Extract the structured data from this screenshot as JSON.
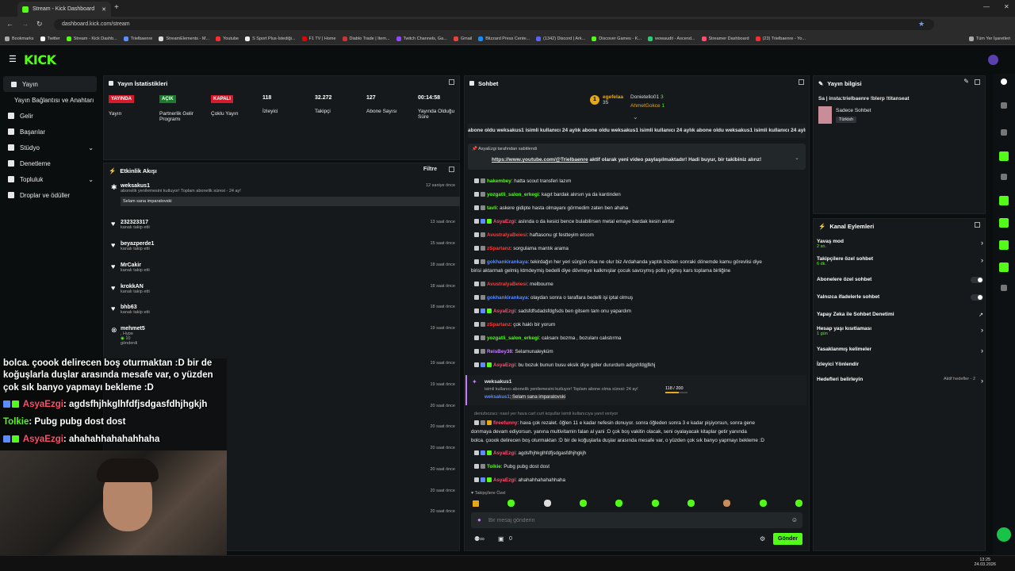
{
  "browser": {
    "tab_title": "Stream - Kick Dashboard",
    "url": "dashboard.kick.com/stream",
    "bookmarks": [
      "Bookmarks",
      "Twitter",
      "Stream - Kick Dashb...",
      "Trielbaenre",
      "StreamElements - M...",
      "Youtube",
      "S Sport Plus-İstediği...",
      "F1 TV | Home",
      "Diablo Trade | Item...",
      "Twitch Channels, Ga...",
      "Gmail",
      "Blizzard Press Cente...",
      "(1342) Discord | Ark...",
      "Discover Games - K...",
      "wowaudit - Ascend...",
      "Streamer Dashboard",
      "(23) Trielbaenre - Yo..."
    ],
    "all_bookmarks": "Tüm Yer İşaretleri"
  },
  "nav": {
    "items": [
      "Yayın",
      "Yayın Bağlantısı ve Anahtarı",
      "Gelir",
      "Başarılar",
      "Stüdyo",
      "Denetleme",
      "Topluluk",
      "Droplar ve ödüller"
    ]
  },
  "stats": {
    "title": "Yayın İstatistikleri",
    "live_tag": "YAYINDA",
    "live_label": "Yayın",
    "partner_tag": "AÇIK",
    "partner_label": "Partnerlik Gelir Programı",
    "multi_tag": "KAPALI",
    "multi_label": "Çoklu Yayın",
    "viewers": "118",
    "viewers_label": "İzleyici",
    "followers": "32.272",
    "followers_label": "Takipçi",
    "subs": "127",
    "subs_label": "Abone Sayısı",
    "uptime": "00:14:58",
    "uptime_label": "Yayında Olduğu Süre"
  },
  "activity": {
    "title": "Etkinlik Akışı",
    "filter": "Filtre",
    "sub_user": "weksakus1",
    "sub_text": "abonelik yenilemesini kutluyor! Toplam abonelik süresi - 24 ay!",
    "sub_time": "12 saniye önce",
    "sub_msg": "Selam sana imparatovski",
    "events": [
      {
        "name": "232323317",
        "desc": "kanalı takip etti",
        "time": "13 saat önce"
      },
      {
        "name": "beyazperde1",
        "desc": "kanalı takip etti",
        "time": "15 saat önce"
      },
      {
        "name": "MrCakir",
        "desc": "kanalı takip etti",
        "time": "18 saat önce"
      },
      {
        "name": "krokkAN",
        "desc": "kanalı takip etti",
        "time": "18 saat önce"
      },
      {
        "name": "bhb63",
        "desc": "kanalı takip etti",
        "time": "18 saat önce"
      },
      {
        "name": "mehmet5",
        "desc": ", Hype",
        "time": "19 saat önce"
      }
    ],
    "hype_amount": "10",
    "hype_sent": "gönderdi",
    "more_times": [
      "19 saat önce",
      "19 saat önce",
      "20 saat önce",
      "20 saat önce",
      "20 saat önce",
      "20 saat önce",
      "20 saat önce",
      "20 saat önce"
    ]
  },
  "chat": {
    "title": "Sohbet",
    "top1_name": "egefelaa",
    "top1_count": "35",
    "top2_name": "Donietello01",
    "top2_count": "3",
    "top3_name": "AhmetGokce",
    "top3_count": "1",
    "ticker": "abone oldu  weksakus1 isimli kullanıcı 24 aylık abone oldu  weksakus1 isimli kullanıcı 24 aylık abone oldu  weksakus1 isimli kullanıcı 24 aylık abone oldu",
    "pinned_by": "AsyaEzgi tarafından sabitlendi",
    "pinned_link": "https://www.youtube.com/@Trielbaenre",
    "pinned_text": " aktif olarak yeni video paylaşılmaktadır! Hadi buyur, bir takibiniz alırız!",
    "messages": [
      {
        "user": "hakembey",
        "color": "#53fc18",
        "text": ": hatta scout transferi lazım"
      },
      {
        "user": "yozgatli_salon_erkegi",
        "color": "#53fc18",
        "text": ": kagıt bardak alırsın ya da kantinden"
      },
      {
        "user": "tavli",
        "color": "#53fc18",
        "text": ": askere gidipte hasta olmayanı görmedim zaten ben ahaha"
      },
      {
        "user": "AsyaEzgi",
        "color": "#ff4d6d",
        "text": ": aslında o da kesici bence bulabilirsen metal emaye bardak kesin alırlar"
      },
      {
        "user": "AvustralyaBeiesi",
        "color": "#ff3b3b",
        "text": ": haftasonu gt festteyim ercom"
      },
      {
        "user": "zSpartanz",
        "color": "#ff3b3b",
        "text": ": sorgulama mantık arama"
      },
      {
        "user": "gokhankirankaya",
        "color": "#5b8dff",
        "text": ": tekirdağın her yeri sürgün olsa ne olur biz Ardahanda yaptık bizden sonraki dönemde kamu görevlisi diye"
      },
      {
        "user": "AvustralyaBeiesi",
        "color": "#ff3b3b",
        "text": ": melbourne"
      },
      {
        "user": "gokhankirankaya",
        "color": "#5b8dff",
        "text": ": olaydan sonra o taraflara bedelli işi iptal olmuş"
      },
      {
        "user": "AsyaEzgi",
        "color": "#ff4d6d",
        "text": ": sadsfdfsdadsfdgfsds ben gitsem tam onu yapardım"
      },
      {
        "user": "zSpartanz",
        "color": "#ff3b3b",
        "text": ": çok haklı bir yorum"
      },
      {
        "user": "yozgatli_salon_erkegi",
        "color": "#53fc18",
        "text": ": calısanı bozma , bozulanı calıstırma"
      },
      {
        "user": "ReisBey38",
        "color": "#c77dff",
        "text": ": Selamunaleyküm"
      },
      {
        "user": "AsyaEzgi",
        "color": "#ff4d6d",
        "text": ": bu bozuk bunun busu eksik diye gider dururdum adgshfdgjfkhj"
      }
    ],
    "wrap_line": "birisi aktarmalı gelmiş ktmdeymiş bedelli diye dövmeye kalkmışlar çocuk savcıymış polis yığmış kars toplama birliğine",
    "sub_user": "weksakus1",
    "sub_text": "isimli kullanıcı abonelik yenilemesini kutluyor! Toplam abone olma süresi: 24 ay!",
    "sub_progress": "118 / 200",
    "sub_reply_user": "weksakus1",
    "sub_reply": ": Selam sana imparatovski",
    "reply_hint": "denizbozacı: nasıl yer hava cart curt koşullar isimli kullanıcıya yanıt veriyor",
    "long_user": "fireefunny",
    "long1": ": hava çok rezalet. öğlen 11 e kadar nefesin donuyor. sonra öğleden sonra 3 e kadar pişiyorsun, sonra gene",
    "long2": "donmaya devam ediyorsun.        yanına multivitamin falan al yani :D çok boş vakitin olacak, seni oyalayacak kitaplar getir yanında",
    "long3": "bolca. çoook delirecen boş oturmaktan :D bir de koğuşlarla duşlar arasında mesafe var, o yüzden çok sık banyo yapmayı bekleme :D",
    "tail": [
      {
        "user": "AsyaEzgi",
        "color": "#ff4d6d",
        "text": ": agdsfhjhkglhfdfjsdgasfdhjhgkjh"
      },
      {
        "user": "Tolkie",
        "color": "#53fc18",
        "text": ": Pubg pubg dost dost"
      },
      {
        "user": "AsyaEzgi",
        "color": "#ff4d6d",
        "text": ": ahahahhahahahhaha"
      }
    ],
    "followers_only": "Takipçilere Özel",
    "input_placeholder": "Bir mesaj gönderin",
    "send_label": "Gönder",
    "counter": "0"
  },
  "info": {
    "title": "Yayın bilgisi",
    "stream_title": "Sa | insta:trielbaenre !blerp !titanseat",
    "category": "Sadece Sohbet",
    "language": "Türkish"
  },
  "actions": {
    "title": "Kanal Eylemleri",
    "slow_mode": "Yavaş mod",
    "slow_sub": "2 sn.",
    "followers_chat": "Takipçilere özel sohbet",
    "followers_sub": "6 dk.",
    "subs_chat": "Abonelere özel sohbet",
    "emote_chat": "Yalnızca ifadelerle sohbet",
    "ai_mod": "Yapay Zeka ile Sohbet Denetimi",
    "account_age": "Hesap yaşı kısıtlaması",
    "account_sub": "1 gün",
    "banned_words": "Yasaklanmış kelimeler",
    "redirect": "İzleyici Yönlendir",
    "goals": "Hedefleri belirleyin",
    "goals_sub": "Aktif hedefler - 2"
  },
  "overlay": {
    "line1": "bolca. çoook delirecen boş oturmaktan :D bir de",
    "line2": "koğuşlarla duşlar arasında mesafe var, o yüzden",
    "line3": "çok sık banyo yapmayı bekleme :D",
    "u1": "AsyaEzgi",
    "m1": ": agdsfhjhkglhfdfjsdgasfdhjhgkjh",
    "u2": "Tolkie",
    "m2": ": Pubg pubg dost dost",
    "u3": "AsyaEzgi",
    "m3": ": ahahahhahahahhaha"
  },
  "taskbar": {
    "time": "13:25",
    "date": "24.03.2026"
  }
}
